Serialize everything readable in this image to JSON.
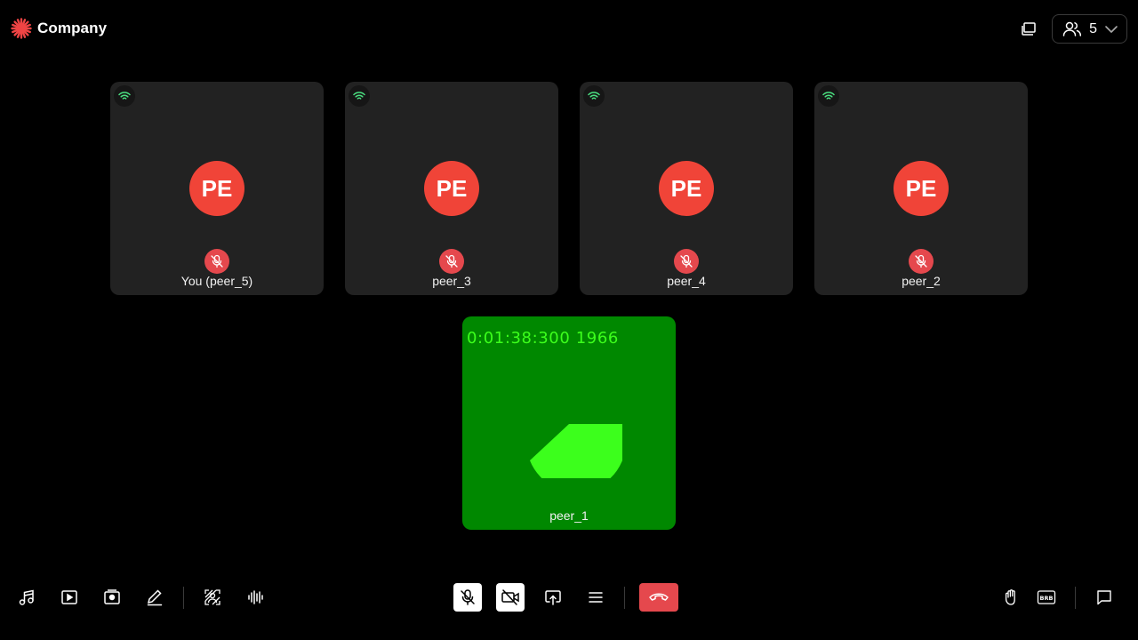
{
  "brand": {
    "name": "Company",
    "icon": "company-star-logo"
  },
  "header": {
    "participants_count": "5",
    "icons": [
      "picture-in-picture-icon",
      "people-icon",
      "chevron-down-icon"
    ]
  },
  "colors": {
    "avatar": "#f04438",
    "muted": "#e5484d",
    "end_call": "#e5484d",
    "signal": "#4ade80",
    "video_tile": "#008800",
    "video_fg": "#3cff1c",
    "tile_bg": "#222222"
  },
  "tiles": [
    {
      "initials": "PE",
      "name": "You (peer_5)",
      "muted": true
    },
    {
      "initials": "PE",
      "name": "peer_3",
      "muted": true
    },
    {
      "initials": "PE",
      "name": "peer_4",
      "muted": true
    },
    {
      "initials": "PE",
      "name": "peer_2",
      "muted": true
    }
  ],
  "video_tile": {
    "name": "peer_1",
    "timecode": "0:01:38:300 1966"
  },
  "toolbar": {
    "left": [
      "music-icon",
      "play-video-icon",
      "video-library-icon",
      "pencil-icon",
      "virtual-background-icon",
      "audio-waveform-icon"
    ],
    "center": [
      "mic-off-icon",
      "camera-off-icon",
      "screen-share-icon",
      "menu-icon",
      "end-call-icon"
    ],
    "right": [
      "raise-hand-icon",
      "brb-icon",
      "chat-icon"
    ],
    "brb_label": "BRB"
  }
}
